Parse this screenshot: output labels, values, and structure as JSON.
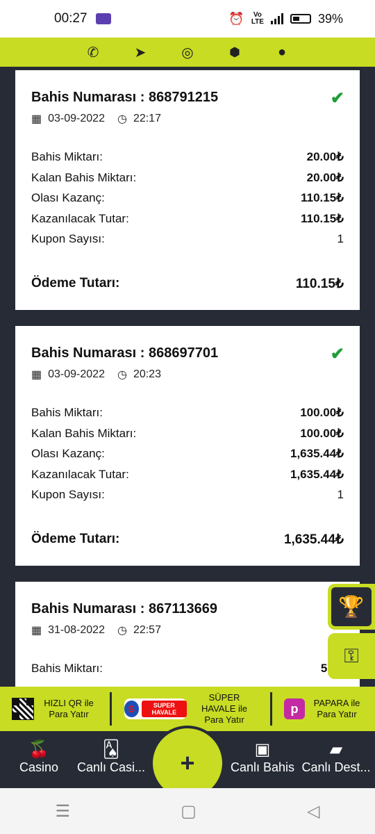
{
  "status_bar": {
    "time": "00:27",
    "network": "Vo LTE 4.5G",
    "battery": "39%"
  },
  "social": [
    {
      "icon": "phone-icon",
      "glyph": "✆"
    },
    {
      "icon": "telegram-icon",
      "glyph": "➤"
    },
    {
      "icon": "instagram-icon",
      "glyph": "◎"
    },
    {
      "icon": "android-icon",
      "glyph": "🤖"
    },
    {
      "icon": "apple-icon",
      "glyph": ""
    }
  ],
  "labels": {
    "bet_number": "Bahis Numarası : ",
    "stake": "Bahis Miktarı:",
    "remaining_stake": "Kalan Bahis Miktarı:",
    "possible_win": "Olası Kazanç:",
    "to_win": "Kazanılacak Tutar:",
    "coupon_count": "Kupon Sayısı:",
    "payment": "Ödeme Tutarı:"
  },
  "bets": [
    {
      "number": "868791215",
      "date": "03-09-2022",
      "time": "22:17",
      "stake": "20.00₺",
      "remaining": "20.00₺",
      "possible": "110.15₺",
      "to_win": "110.15₺",
      "coupons": "1",
      "payment": "110.15₺",
      "status": "won"
    },
    {
      "number": "868697701",
      "date": "03-09-2022",
      "time": "20:23",
      "stake": "100.00₺",
      "remaining": "100.00₺",
      "possible": "1,635.44₺",
      "to_win": "1,635.44₺",
      "coupons": "1",
      "payment": "1,635.44₺",
      "status": "won"
    },
    {
      "number": "867113669",
      "date": "31-08-2022",
      "time": "22:57",
      "stake": "50.0"
    }
  ],
  "side_buttons": [
    "trophy-icon",
    "key-icon"
  ],
  "payments": [
    {
      "label": "HIZLI QR ile Para Yatır"
    },
    {
      "logo": "SUPER HAVALE",
      "label": "SÜPER HAVALE ile Para Yatır"
    },
    {
      "label": "PAPARA ile Para Yatır",
      "logo": "p"
    }
  ],
  "bottom_nav": {
    "casino": "Casino",
    "live_casino": "Canlı Casi...",
    "plus": "+",
    "live_bet": "Canlı Bahis",
    "live_support": "Canlı Dest..."
  },
  "colors": {
    "accent": "#c7dc23",
    "dark": "#262b36",
    "check": "#1f9d3a"
  }
}
